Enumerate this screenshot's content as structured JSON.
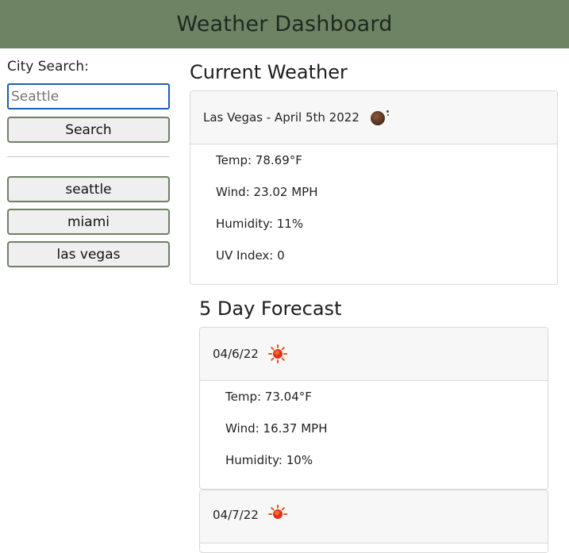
{
  "header": {
    "title": "Weather Dashboard"
  },
  "sidebar": {
    "search_label": "City Search:",
    "search_value": "Seattle",
    "search_placeholder": "Seattle",
    "search_button": "Search",
    "history": [
      "seattle",
      "miami",
      "las vegas"
    ]
  },
  "current": {
    "section_title": "Current Weather",
    "header": "Las Vegas - April 5th 2022",
    "icon": "night-clear-moon-icon",
    "temp": "Temp: 78.69°F",
    "wind": "Wind: 23.02 MPH",
    "humidity": "Humidity: 11%",
    "uv": "UV Index: 0"
  },
  "forecast": {
    "section_title": "5 Day Forecast",
    "days": [
      {
        "date": "04/6/22",
        "icon": "sun-icon",
        "temp": "Temp: 73.04°F",
        "wind": "Wind: 16.37 MPH",
        "humidity": "Humidity: 10%"
      },
      {
        "date": "04/7/22",
        "icon": "sun-icon"
      }
    ]
  },
  "colors": {
    "header_bg": "#6e8264",
    "button_border": "#6f8064",
    "input_focus": "#1a5fb4",
    "sun": "#f5a623"
  }
}
